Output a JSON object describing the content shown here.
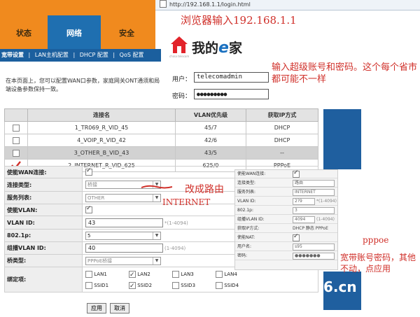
{
  "nav": {
    "tabs": [
      "状态",
      "网络",
      "安全"
    ],
    "subnav": [
      "宽带设置",
      "|",
      "LAN主机配置",
      "|",
      "DHCP 配置",
      "|",
      "QoS 配置"
    ],
    "description": "在本页面上，您可以配置WAN口参数，家庭网关ONT通须和局端设备参数保持一致。"
  },
  "browser": {
    "url": "http://192.168.1.1/login.html"
  },
  "annotations": {
    "browser_tip": "浏览器输入192.168.1.1",
    "login_tip": "输入超级账号和密码。这个每个省市都可能不一样",
    "change_route": "改成路由",
    "internet": "INTERNET",
    "pppoe": "pppoe",
    "account_tip": "宽带账号密码，其他不动，点应用"
  },
  "logo": {
    "text": "我的",
    "e": "e",
    "suffix": "家",
    "small": "china telecom"
  },
  "login": {
    "user_label": "用户：",
    "user_value": "telecomadmin",
    "pass_label": "密码：",
    "pass_value": "●●●●●●●●●"
  },
  "wan_table": {
    "headers": [
      "",
      "连接名",
      "VLAN优先级",
      "获取IP方式"
    ],
    "rows": [
      {
        "name": "1_TR069_R_VID_45",
        "vlan": "45/7",
        "ip": "DHCP"
      },
      {
        "name": "4_VOIP_R_VID_42",
        "vlan": "42/6",
        "ip": "DHCP"
      },
      {
        "name": "3_OTHER_B_VID_43",
        "vlan": "43/5",
        "ip": "--"
      },
      {
        "name": "2_INTERNET_R_VID_625",
        "vlan": "625/0",
        "ip": "PPPoE"
      }
    ]
  },
  "form": {
    "enable_wan": "使能WAN连接:",
    "conn_type": "连接类型:",
    "conn_type_value": "桥接",
    "service_list": "服务列表:",
    "service_value": "OTHER",
    "enable_vlan": "使能VLAN:",
    "vlan_id": "VLAN ID:",
    "vlan_id_value": "43",
    "vlan_id_hint": "*(1-4094)",
    "dot1p": "802.1p:",
    "dot1p_value": "5",
    "mcast_vlan": "组播VLAN ID:",
    "mcast_value": "40",
    "mcast_hint": "(1-4094)",
    "bridge_type": "桥类型:",
    "bridge_value": "PPPoE桥接",
    "bind": "绑定项:",
    "bind_items": [
      "LAN1",
      "LAN2",
      "LAN3",
      "LAN4",
      "SSID1",
      "SSID2",
      "SSID3",
      "SSID4"
    ],
    "bind_checked": [
      false,
      true,
      false,
      false,
      false,
      true,
      false,
      false
    ],
    "apply": "应用",
    "cancel": "取消"
  },
  "panel2": {
    "rows": [
      {
        "label": "使能WAN连接:",
        "value": ""
      },
      {
        "label": "连接类型:",
        "value": "路由"
      },
      {
        "label": "服务列表:",
        "value": "INTERNET"
      },
      {
        "label": "VLAN ID:",
        "value": "2?9",
        "hint": "*(1-4094)"
      },
      {
        "label": "802.1p:",
        "value": "3"
      },
      {
        "label": "组播VLAN ID:",
        "value": "4094",
        "hint": "(1-4094)"
      },
      {
        "label": "获取IP方式:",
        "value": "DHCP   静态   PPPoE"
      },
      {
        "label": "使能NAT:",
        "value": ""
      },
      {
        "label": "用户名:",
        "value": "s95"
      },
      {
        "label": "密码:",
        "value": "●●●●●●●"
      }
    ]
  },
  "watermark": {
    "text": "6.cn"
  }
}
